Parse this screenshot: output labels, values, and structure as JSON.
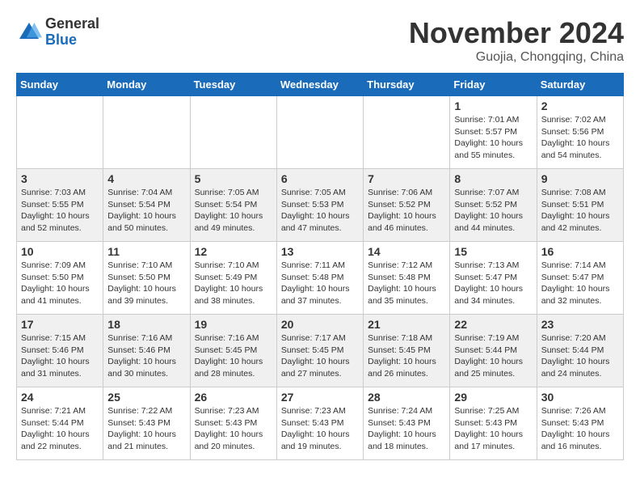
{
  "logo": {
    "general": "General",
    "blue": "Blue"
  },
  "title": {
    "month": "November 2024",
    "location": "Guojia, Chongqing, China"
  },
  "headers": [
    "Sunday",
    "Monday",
    "Tuesday",
    "Wednesday",
    "Thursday",
    "Friday",
    "Saturday"
  ],
  "weeks": [
    [
      {
        "day": "",
        "content": ""
      },
      {
        "day": "",
        "content": ""
      },
      {
        "day": "",
        "content": ""
      },
      {
        "day": "",
        "content": ""
      },
      {
        "day": "",
        "content": ""
      },
      {
        "day": "1",
        "content": "Sunrise: 7:01 AM\nSunset: 5:57 PM\nDaylight: 10 hours\nand 55 minutes."
      },
      {
        "day": "2",
        "content": "Sunrise: 7:02 AM\nSunset: 5:56 PM\nDaylight: 10 hours\nand 54 minutes."
      }
    ],
    [
      {
        "day": "3",
        "content": "Sunrise: 7:03 AM\nSunset: 5:55 PM\nDaylight: 10 hours\nand 52 minutes."
      },
      {
        "day": "4",
        "content": "Sunrise: 7:04 AM\nSunset: 5:54 PM\nDaylight: 10 hours\nand 50 minutes."
      },
      {
        "day": "5",
        "content": "Sunrise: 7:05 AM\nSunset: 5:54 PM\nDaylight: 10 hours\nand 49 minutes."
      },
      {
        "day": "6",
        "content": "Sunrise: 7:05 AM\nSunset: 5:53 PM\nDaylight: 10 hours\nand 47 minutes."
      },
      {
        "day": "7",
        "content": "Sunrise: 7:06 AM\nSunset: 5:52 PM\nDaylight: 10 hours\nand 46 minutes."
      },
      {
        "day": "8",
        "content": "Sunrise: 7:07 AM\nSunset: 5:52 PM\nDaylight: 10 hours\nand 44 minutes."
      },
      {
        "day": "9",
        "content": "Sunrise: 7:08 AM\nSunset: 5:51 PM\nDaylight: 10 hours\nand 42 minutes."
      }
    ],
    [
      {
        "day": "10",
        "content": "Sunrise: 7:09 AM\nSunset: 5:50 PM\nDaylight: 10 hours\nand 41 minutes."
      },
      {
        "day": "11",
        "content": "Sunrise: 7:10 AM\nSunset: 5:50 PM\nDaylight: 10 hours\nand 39 minutes."
      },
      {
        "day": "12",
        "content": "Sunrise: 7:10 AM\nSunset: 5:49 PM\nDaylight: 10 hours\nand 38 minutes."
      },
      {
        "day": "13",
        "content": "Sunrise: 7:11 AM\nSunset: 5:48 PM\nDaylight: 10 hours\nand 37 minutes."
      },
      {
        "day": "14",
        "content": "Sunrise: 7:12 AM\nSunset: 5:48 PM\nDaylight: 10 hours\nand 35 minutes."
      },
      {
        "day": "15",
        "content": "Sunrise: 7:13 AM\nSunset: 5:47 PM\nDaylight: 10 hours\nand 34 minutes."
      },
      {
        "day": "16",
        "content": "Sunrise: 7:14 AM\nSunset: 5:47 PM\nDaylight: 10 hours\nand 32 minutes."
      }
    ],
    [
      {
        "day": "17",
        "content": "Sunrise: 7:15 AM\nSunset: 5:46 PM\nDaylight: 10 hours\nand 31 minutes."
      },
      {
        "day": "18",
        "content": "Sunrise: 7:16 AM\nSunset: 5:46 PM\nDaylight: 10 hours\nand 30 minutes."
      },
      {
        "day": "19",
        "content": "Sunrise: 7:16 AM\nSunset: 5:45 PM\nDaylight: 10 hours\nand 28 minutes."
      },
      {
        "day": "20",
        "content": "Sunrise: 7:17 AM\nSunset: 5:45 PM\nDaylight: 10 hours\nand 27 minutes."
      },
      {
        "day": "21",
        "content": "Sunrise: 7:18 AM\nSunset: 5:45 PM\nDaylight: 10 hours\nand 26 minutes."
      },
      {
        "day": "22",
        "content": "Sunrise: 7:19 AM\nSunset: 5:44 PM\nDaylight: 10 hours\nand 25 minutes."
      },
      {
        "day": "23",
        "content": "Sunrise: 7:20 AM\nSunset: 5:44 PM\nDaylight: 10 hours\nand 24 minutes."
      }
    ],
    [
      {
        "day": "24",
        "content": "Sunrise: 7:21 AM\nSunset: 5:44 PM\nDaylight: 10 hours\nand 22 minutes."
      },
      {
        "day": "25",
        "content": "Sunrise: 7:22 AM\nSunset: 5:43 PM\nDaylight: 10 hours\nand 21 minutes."
      },
      {
        "day": "26",
        "content": "Sunrise: 7:23 AM\nSunset: 5:43 PM\nDaylight: 10 hours\nand 20 minutes."
      },
      {
        "day": "27",
        "content": "Sunrise: 7:23 AM\nSunset: 5:43 PM\nDaylight: 10 hours\nand 19 minutes."
      },
      {
        "day": "28",
        "content": "Sunrise: 7:24 AM\nSunset: 5:43 PM\nDaylight: 10 hours\nand 18 minutes."
      },
      {
        "day": "29",
        "content": "Sunrise: 7:25 AM\nSunset: 5:43 PM\nDaylight: 10 hours\nand 17 minutes."
      },
      {
        "day": "30",
        "content": "Sunrise: 7:26 AM\nSunset: 5:43 PM\nDaylight: 10 hours\nand 16 minutes."
      }
    ]
  ]
}
